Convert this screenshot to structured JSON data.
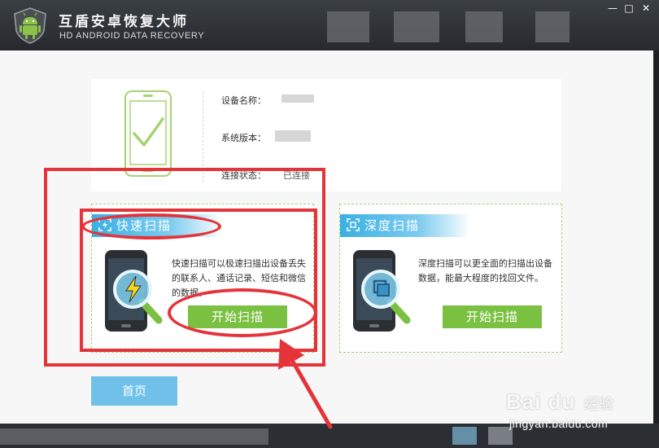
{
  "window": {
    "title_cn": "互盾安卓恢复大师",
    "title_en": "HD ANDROID DATA RECOVERY",
    "minimize_glyph": "—",
    "maximize_glyph": "□",
    "close_glyph": "✕"
  },
  "device": {
    "name_label": "设备名称：",
    "version_label": "系统版本：",
    "status_label": "连接状态：",
    "status_value": "已连接"
  },
  "quick_scan": {
    "title": "快速扫描",
    "description": "快速扫描可以极速扫描出设备丢失的联系人、通话记录、短信和微信的数据。",
    "button": "开始扫描"
  },
  "deep_scan": {
    "title": "深度扫描",
    "description": "深度扫描可以更全面的扫描出设备数据，能最大程度的找回文件。",
    "button": "开始扫描"
  },
  "nav": {
    "home_button": "首页"
  },
  "watermark": {
    "brand": "Bai du",
    "cn": "经验",
    "url": "jingyan.baidu.com"
  },
  "icons": {
    "logo": "android-shield-icon",
    "device_status": "phone-check-icon",
    "quick_scan": "phone-lightning-magnifier-icon",
    "deep_scan": "phone-layers-magnifier-icon"
  },
  "colors": {
    "titlebar": "#2e3236",
    "accent_green": "#7ac142",
    "accent_blue": "#3ab0e2",
    "home_button": "#6fc1ea",
    "annotation_red": "#e5333a"
  }
}
